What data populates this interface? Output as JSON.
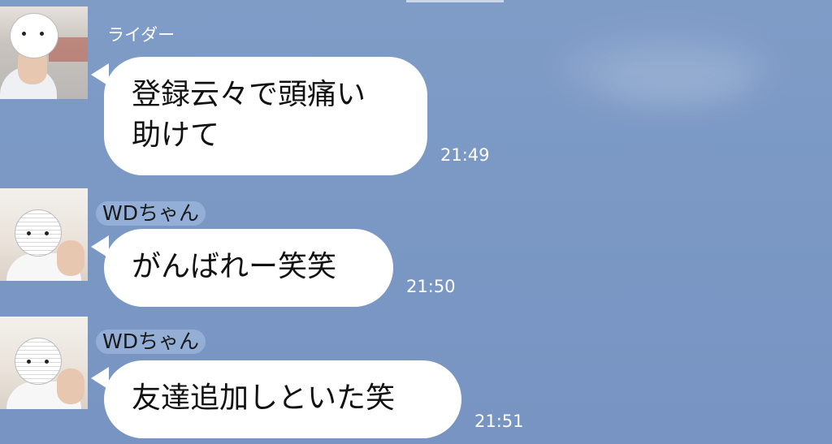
{
  "messages": [
    {
      "sender": "ライダー",
      "text": "登録云々で頭痛い\n助けて",
      "time": "21:49",
      "avatar_icon": "user-photo-avatar"
    },
    {
      "sender": "WDちゃん",
      "text": "がんばれー笑笑",
      "time": "21:50",
      "avatar_icon": "user-photo-avatar"
    },
    {
      "sender": "WDちゃん",
      "text": "友達追加しといた笑",
      "time": "21:51",
      "avatar_icon": "user-photo-avatar"
    }
  ],
  "colors": {
    "background": "#7f9cc7",
    "bubble": "#ffffff",
    "text": "#111111",
    "meta_text": "#ffffff"
  }
}
